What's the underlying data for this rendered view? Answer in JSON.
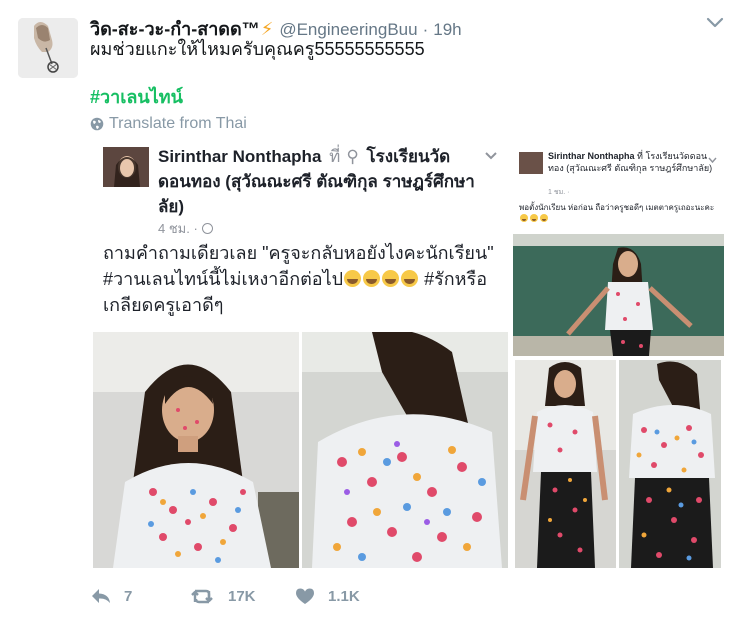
{
  "tweet": {
    "display_name": "วิด-สะ-วะ-กำ-สาดด™",
    "display_name_badge": "⚡",
    "handle": "@EngineeringBuu",
    "separator": "·",
    "time": "19h",
    "text": "ผมช่วยแกะให้ไหมครับคุณครู55555555555",
    "hashtag": "#วาเลนไทน์",
    "translate_label": "Translate from Thai",
    "avatar_icon": "user-avatar-icon"
  },
  "post": {
    "author": "Sirinthar Nonthapha",
    "at_word": "ที่",
    "place": "โรงเรียนวัดดอนทอง (สุวัณณะศรี ตัณฑิกุล ราษฎร์ศึกษาลัย)",
    "time": "4 ชม. ·",
    "body_line1": "ถามคำถามเดียวเลย \"ครูจะกลับหอยังไงคะนักเรียน\"",
    "body_line2a": "#วานเลนไทน์นี้ไม่เหงาอีกต่อไป",
    "body_line2b": " #รักหรือ",
    "body_line3": "เกลียดครูเอาดีๆ",
    "emoji_count": 4
  },
  "mini_post": {
    "author": "Sirinthar Nonthapha",
    "at_word": "ที่",
    "place": "โรงเรียนวัดดอนทอง (สุวัณณะศรี ตัณฑิกุล ราษฎร์ศึกษาลัย)",
    "time": "1 ชม. ·",
    "body": "พอตั้งนักเรียน ห่อก่อน ถือว่าครูชอดีๆ เมตตาครูเถอะนะคะ"
  },
  "actions": {
    "reply_count": "7",
    "retweet_count": "17K",
    "like_count": "1.1K"
  },
  "colors": {
    "hashtag": "#17bf63",
    "muted": "#8899a6",
    "text": "#14171a",
    "badge": "#f5a623"
  }
}
